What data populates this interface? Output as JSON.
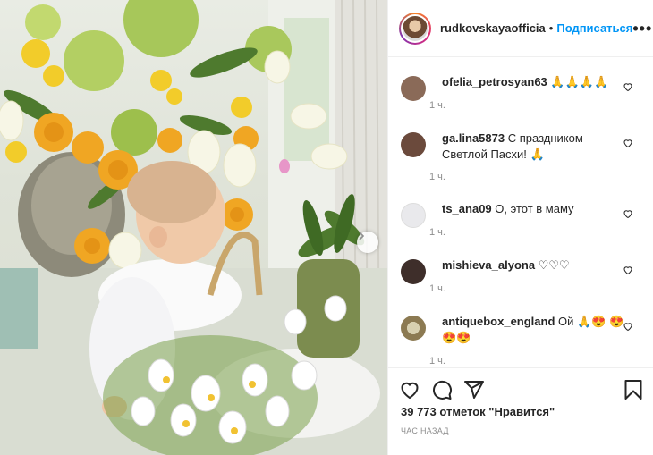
{
  "post": {
    "username": "rudkovskayaofficia",
    "separator": "•",
    "follow_label": "Подписаться",
    "more_label": "•••",
    "likes_text": "39 773 отметок \"Нравится\"",
    "time_ago": "ЧАС НАЗАД"
  },
  "comments": [
    {
      "user": "ofelia_petrosyan63",
      "text": "🙏🙏🙏🙏",
      "time": "1 ч.",
      "avatar_color": "#8a6a58"
    },
    {
      "user": "ga.lina5873",
      "text": "С праздником Светлой Пасхи! 🙏",
      "time": "1 ч.",
      "avatar_color": "#6b4a3c"
    },
    {
      "user": "ts_ana09",
      "text": "О, этот в маму",
      "time": "1 ч.",
      "avatar_color": "#e9e9ec"
    },
    {
      "user": "mishieva_alyona",
      "text": "♡♡♡",
      "time": "1 ч.",
      "avatar_color": "#3e2e2a"
    },
    {
      "user": "antiquebox_england",
      "text": "Ой 🙏😍 😍😍😍",
      "time": "1 ч.",
      "avatar_color": "#8c7a52"
    }
  ],
  "icons": {
    "like": "heart-icon",
    "comment": "comment-icon",
    "share": "share-icon",
    "save": "bookmark-icon",
    "next": "chevron-right-icon"
  },
  "colors": {
    "accent": "#0095f6",
    "text": "#262626",
    "muted": "#8e8e8e"
  }
}
